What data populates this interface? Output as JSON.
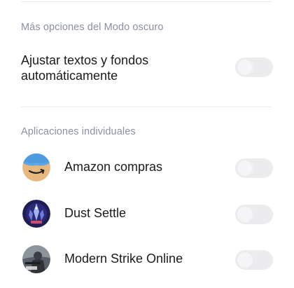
{
  "dark_mode_more_options": {
    "section_label": "Más opciones del Modo oscuro",
    "auto_adjust": {
      "label": "Ajustar textos y fondos automáticamente",
      "enabled": false
    }
  },
  "individual_apps": {
    "section_label": "Aplicaciones individuales",
    "apps": [
      {
        "name": "Amazon compras",
        "icon": "amazon-shopping-icon",
        "enabled": false
      },
      {
        "name": "Dust Settle",
        "icon": "dust-settle-icon",
        "enabled": false
      },
      {
        "name": "Modern Strike Online",
        "icon": "modern-strike-online-icon",
        "enabled": false
      }
    ]
  },
  "colors": {
    "section_label": "#8a8fa6",
    "toggle_off_track": "#ececef",
    "divider": "#e9e9ee"
  }
}
